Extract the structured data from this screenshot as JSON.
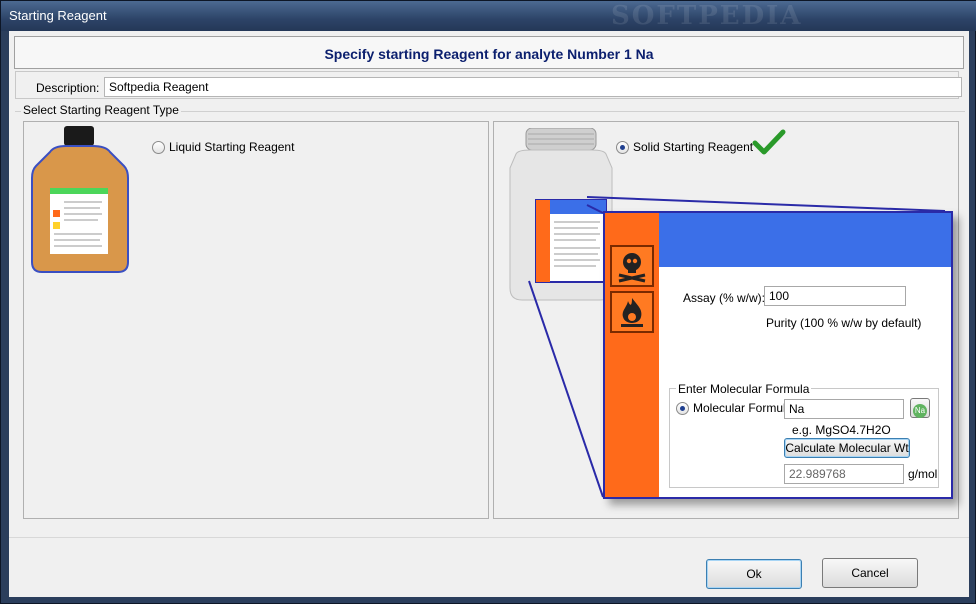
{
  "window": {
    "title": "Starting Reagent",
    "watermark": "SOFTPEDIA"
  },
  "header": {
    "heading": "Specify starting Reagent for analyte Number 1 Na"
  },
  "description": {
    "label": "Description:",
    "value": "Softpedia Reagent"
  },
  "reagent_type": {
    "group_label": "Select Starting Reagent Type",
    "liquid_label": "Liquid Starting Reagent",
    "liquid_selected": false,
    "solid_label": "Solid Starting Reagent",
    "solid_selected": true
  },
  "zoom": {
    "assay_label": "Assay (% w/w):",
    "assay_value": "100",
    "purity_note": "Purity (100 % w/w by default)",
    "formula_group_label": "Enter Molecular Formula",
    "formula_radio_label": "Molecular Formula:",
    "formula_value": "Na",
    "element_button": "Na",
    "example": "e.g. MgSO4.7H2O",
    "calculate_button": "Calculate Molecular Wt",
    "mol_weight_value": "22.989768",
    "mol_weight_unit": "g/mol"
  },
  "footer": {
    "ok_label": "Ok",
    "cancel_label": "Cancel"
  },
  "colors": {
    "accent_blue": "#3b6fe8",
    "hazard_orange": "#ff6a1a",
    "heading": "#0b1f6e"
  }
}
